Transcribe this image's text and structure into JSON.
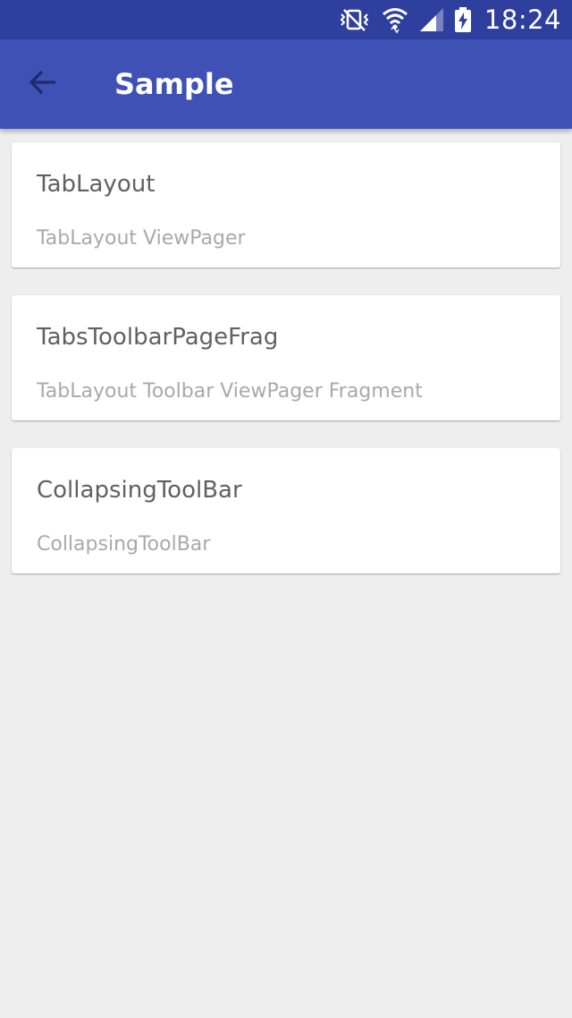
{
  "status_bar": {
    "time": "18:24",
    "icons": [
      "vibrate-mute-icon",
      "wifi-icon",
      "signal-icon",
      "battery-charging-icon"
    ]
  },
  "app_bar": {
    "title": "Sample",
    "back_icon": "arrow-back-icon"
  },
  "colors": {
    "status_bar": "#2f3f9e",
    "app_bar": "#3f51b5",
    "background": "#eeeeee",
    "card": "#ffffff",
    "title_text": "#616161",
    "subtitle_text": "#a9a9a9"
  },
  "list": {
    "items": [
      {
        "title": "TabLayout",
        "subtitle": "TabLayout ViewPager"
      },
      {
        "title": "TabsToolbarPageFrag",
        "subtitle": "TabLayout Toolbar ViewPager Fragment"
      },
      {
        "title": "CollapsingToolBar",
        "subtitle": "CollapsingToolBar"
      }
    ]
  }
}
